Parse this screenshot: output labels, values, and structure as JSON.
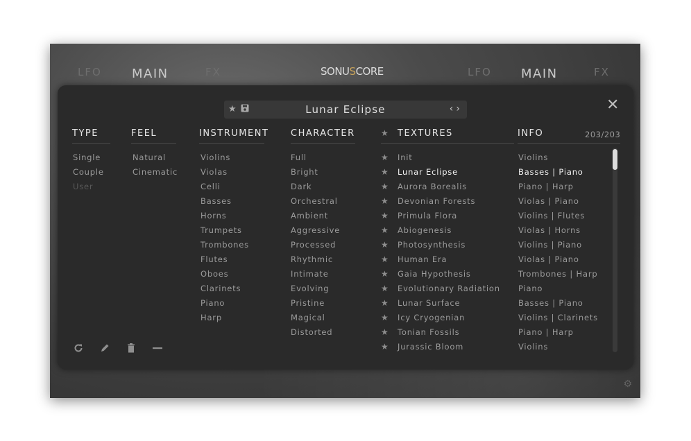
{
  "top_nav": {
    "left": [
      "LFO",
      "MAIN",
      "FX"
    ],
    "right": [
      "LFO",
      "MAIN",
      "FX"
    ],
    "active": "MAIN"
  },
  "logo": {
    "prefix": "SONU",
    "accent": "S",
    "suffix": "CORE"
  },
  "preset": {
    "name": "Lunar Eclipse",
    "star_icon": "star-icon",
    "save_icon": "save-icon",
    "nav_icon": "prev-next-icon"
  },
  "columns": {
    "type": {
      "header": "TYPE",
      "items": [
        "Single",
        "Couple",
        "User"
      ]
    },
    "feel": {
      "header": "FEEL",
      "items": [
        "Natural",
        "Cinematic"
      ]
    },
    "instrument": {
      "header": "INSTRUMENT",
      "items": [
        "Violins",
        "Violas",
        "Celli",
        "Basses",
        "Horns",
        "Trumpets",
        "Trombones",
        "Flutes",
        "Oboes",
        "Clarinets",
        "Piano",
        "Harp"
      ]
    },
    "character": {
      "header": "CHARACTER",
      "items": [
        "Full",
        "Bright",
        "Dark",
        "Orchestral",
        "Ambient",
        "Aggressive",
        "Processed",
        "Rhythmic",
        "Intimate",
        "Evolving",
        "Pristine",
        "Magical",
        "Distorted"
      ]
    },
    "textures": {
      "header": "TEXTURES",
      "items": [
        "Init",
        "Lunar Eclipse",
        "Aurora Borealis",
        "Devonian Forests",
        "Primula Flora",
        "Abiogenesis",
        "Photosynthesis",
        "Human Era",
        "Gaia Hypothesis",
        "Evolutionary Radiation",
        "Lunar Surface",
        "Icy Cryogenian",
        "Tonian Fossils",
        "Jurassic Bloom"
      ]
    },
    "info": {
      "header": "INFO",
      "count": "203/203",
      "items": [
        "Violins",
        "Basses | Piano",
        "Piano | Harp",
        "Violas | Piano",
        "Violins | Flutes",
        "Violas | Horns",
        "Violins | Piano",
        "Violas | Piano",
        "Trombones | Harp",
        "Piano",
        "Basses | Piano",
        "Violins | Clarinets",
        "Piano | Harp",
        "Violins"
      ]
    }
  },
  "selected_texture": "Lunar Eclipse",
  "toolbar": [
    "refresh-icon",
    "edit-icon",
    "delete-icon",
    "minus-icon"
  ],
  "colors": {
    "accent": "#c9a35a",
    "panel": "#2a2a2a",
    "text": "#9b9b9b",
    "selected": "#f2f2f2"
  }
}
